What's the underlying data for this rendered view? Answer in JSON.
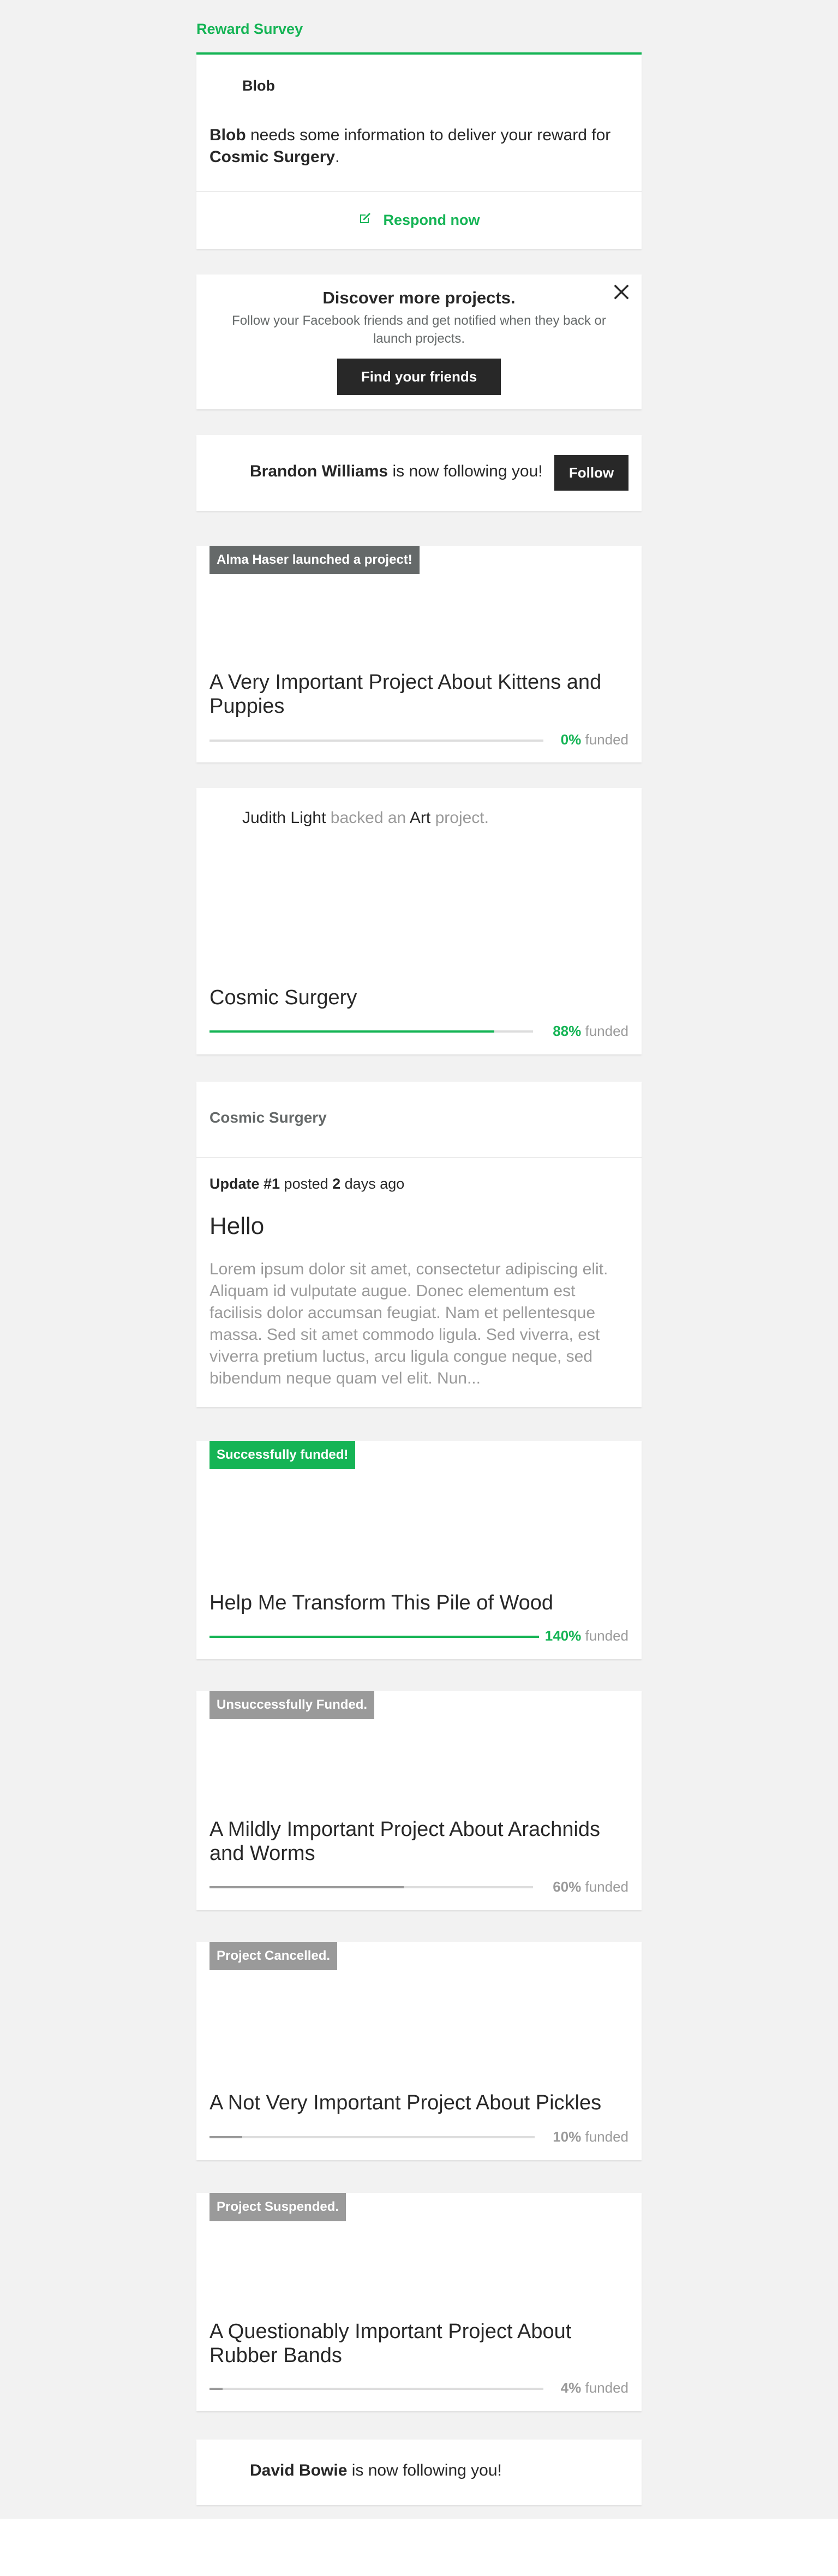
{
  "reward": {
    "section_title": "Reward Survey",
    "sender": "Blob",
    "text_name": "Blob",
    "text_middle": " needs some information to deliver your reward for ",
    "text_project": "Cosmic Surgery",
    "text_end": ".",
    "respond_label": "Respond now"
  },
  "discover": {
    "title": "Discover more projects.",
    "subtitle": "Follow your Facebook friends and get notified when they back or launch projects.",
    "button_label": "Find your friends"
  },
  "follow1": {
    "name": "Brandon Williams",
    "text": " is now following you!",
    "button_label": "Follow"
  },
  "launch": {
    "badge": "Alma Haser launched a project!",
    "title": "A Very Important Project About Kittens and Puppies",
    "progress": 0,
    "percent": "0%",
    "funded_label": " funded"
  },
  "backed": {
    "name": "Judith Light",
    "text1": " backed an ",
    "category": "Art",
    "text2": " project.",
    "title": "Cosmic Surgery",
    "progress": 0.88,
    "percent": "88%",
    "funded_label": " funded"
  },
  "update": {
    "project": "Cosmic Surgery",
    "label": "Update #1",
    "posted": " posted ",
    "days": "2",
    "ago": " days ago",
    "title": "Hello",
    "body": "Lorem ipsum dolor sit amet, consectetur adipiscing elit. Aliquam id vulputate augue. Donec elementum est facilisis dolor accumsan feugiat. Nam et pellentesque massa. Sed sit amet commodo ligula. Sed viverra, est viverra pretium luctus, arcu ligula congue neque, sed bibendum neque quam vel elit. Nun..."
  },
  "success": {
    "badge": "Successfully funded!",
    "title": "Help Me Transform This Pile of Wood",
    "progress": 1.0,
    "percent": "140%",
    "funded_label": " funded"
  },
  "unsuccessful": {
    "badge": "Unsuccessfully Funded.",
    "title": "A Mildly Important Project About Arachnids and Worms",
    "progress": 0.6,
    "percent": "60%",
    "funded_label": " funded"
  },
  "cancelled": {
    "badge": "Project Cancelled.",
    "title": "A Not Very Important Project About Pickles",
    "progress": 0.1,
    "percent": "10%",
    "funded_label": " funded"
  },
  "suspended": {
    "badge": "Project Suspended.",
    "title": "A Questionably Important Project About Rubber Bands",
    "progress": 0.04,
    "percent": "4%",
    "funded_label": " funded"
  },
  "follow2": {
    "name": "David Bowie",
    "text": " is now following you!"
  },
  "colors": {
    "green": "#15b455",
    "dark_gray_badge": "#656969",
    "gray_badge": "#9a9a9a",
    "dark_button": "#282828",
    "background": "#f2f2f2"
  },
  "icons": {
    "respond": "edit-icon",
    "close": "close-icon"
  }
}
